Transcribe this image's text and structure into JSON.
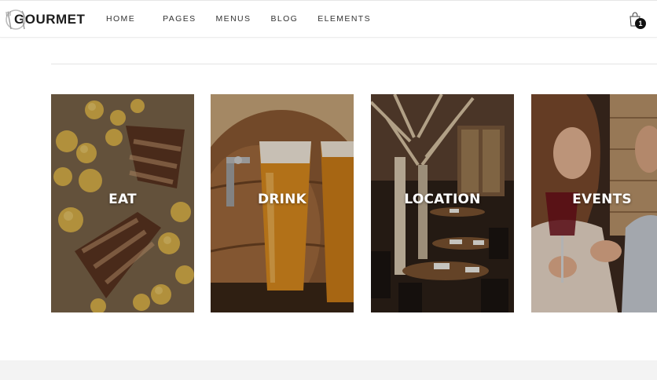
{
  "brand": {
    "name": "GOURMET"
  },
  "nav": {
    "items": [
      {
        "label": "HOME"
      },
      {
        "label": "PAGES"
      },
      {
        "label": "MENUS"
      },
      {
        "label": "BLOG"
      },
      {
        "label": "ELEMENTS"
      }
    ]
  },
  "cart": {
    "count": "1",
    "icon": "shopping-bag-icon"
  },
  "tiles": [
    {
      "label": "EAT",
      "image": "grilled-ribs-and-potatoes"
    },
    {
      "label": "DRINK",
      "image": "beer-glasses-and-barrel-tap"
    },
    {
      "label": "LOCATION",
      "image": "restaurant-interior"
    },
    {
      "label": "EVENTS",
      "image": "couple-with-wine"
    }
  ],
  "colors": {
    "text": "#333333",
    "header_bg": "#ffffff",
    "footer_band": "#f3f3f3",
    "badge": "#111111"
  }
}
